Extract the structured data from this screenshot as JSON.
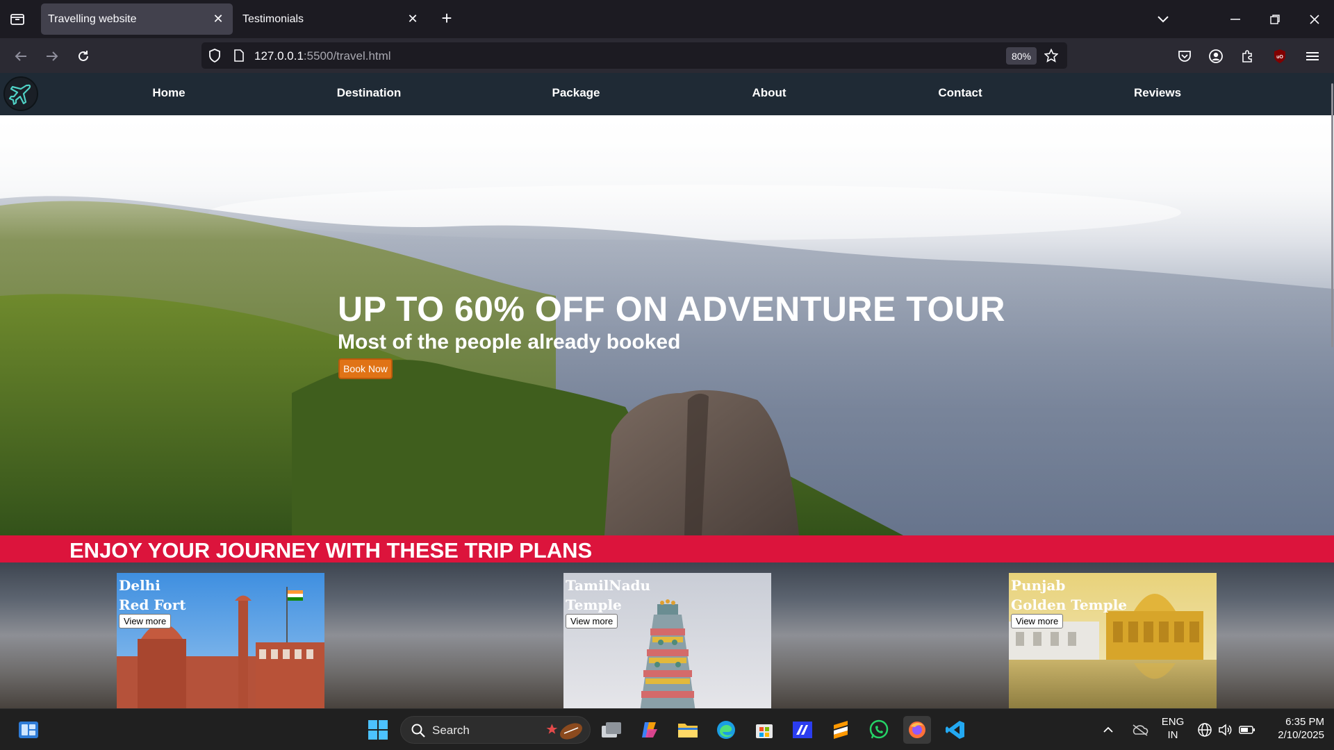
{
  "browser": {
    "tabs": [
      {
        "title": "Travelling website",
        "active": true
      },
      {
        "title": "Testimonials",
        "active": false
      }
    ],
    "url_host": "127.0.0.1",
    "url_rest": ":5500/travel.html",
    "zoom": "80%"
  },
  "site": {
    "nav": [
      "Home",
      "Destination",
      "Package",
      "About",
      "Contact",
      "Reviews"
    ],
    "hero": {
      "title": "UP TO 60% OFF ON ADVENTURE TOUR",
      "subtitle": "Most of the people already booked",
      "button": "Book Now"
    },
    "trips_heading": "ENJOY YOUR JOURNEY WITH THESE TRIP PLANS",
    "cards": [
      {
        "line1": "Delhi",
        "line2": "Red Fort",
        "button": "View more"
      },
      {
        "line1": "TamilNadu",
        "line2": "Temple",
        "button": "View more"
      },
      {
        "line1": "Punjab",
        "line2": "Golden Temple",
        "button": "View more"
      }
    ]
  },
  "taskbar": {
    "search_placeholder": "Search",
    "lang_line1": "ENG",
    "lang_line2": "IN",
    "time": "6:35 PM",
    "date": "2/10/2025"
  },
  "colors": {
    "accent_red": "#dc143c",
    "book_button": "#e07316",
    "site_nav": "#1f2a35"
  }
}
